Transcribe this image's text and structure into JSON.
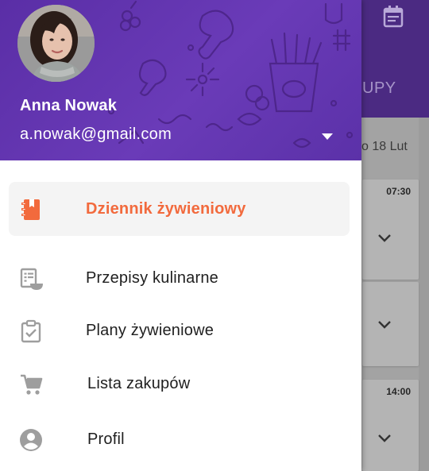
{
  "user": {
    "name": "Anna Nowak",
    "email": "a.nowak@gmail.com"
  },
  "menu": {
    "items": [
      {
        "label": "Dziennik żywieniowy",
        "icon": "notebook-icon",
        "active": true
      },
      {
        "label": "Przepisy kulinarne",
        "icon": "recipe-list-icon",
        "active": false
      },
      {
        "label": "Plany żywieniowe",
        "icon": "clipboard-check-icon",
        "active": false
      },
      {
        "label": "Lista zakupów",
        "icon": "cart-icon",
        "active": false
      },
      {
        "label": "Profil",
        "icon": "account-circle-icon",
        "active": false
      }
    ]
  },
  "background": {
    "tab_partial": "UPY",
    "date_partial": "o 18 Lut",
    "cards": [
      {
        "time": "07:30"
      },
      {
        "time": ""
      },
      {
        "time": "14:00"
      }
    ]
  },
  "colors": {
    "header_purple": "#5a2ea6",
    "accent_orange": "#f26a3d",
    "icon_grey": "#9e9e9e"
  }
}
